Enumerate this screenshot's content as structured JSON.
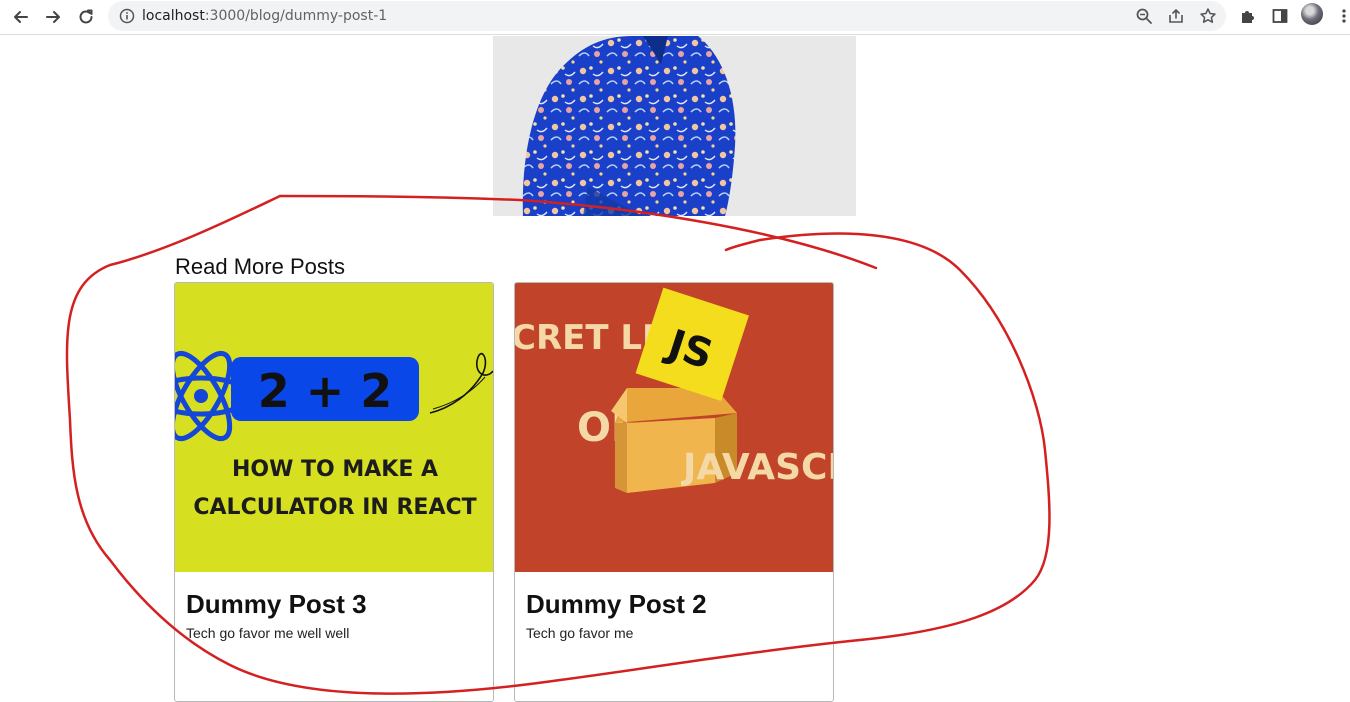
{
  "browser": {
    "url_host": "localhost",
    "url_path": ":3000/blog/dummy-post-1"
  },
  "page": {
    "section_title": "Read More Posts"
  },
  "posts": [
    {
      "title": "Dummy Post 3",
      "description": "Tech go favor me well well",
      "thumbnail": {
        "equation": "2 + 2",
        "line1": "HOW TO MAKE A",
        "line2": "CALCULATOR IN REACT",
        "background": "#d6e020"
      }
    },
    {
      "title": "Dummy Post 2",
      "description": "Tech go favor me",
      "thumbnail": {
        "word1": "CRET LIFE",
        "word2": "OF",
        "word3": "JAVASCRI",
        "badge": "JS",
        "background": "#c0432a"
      }
    }
  ],
  "colors": {
    "annotation": "#d42020",
    "react_blue": "#1446d8"
  }
}
